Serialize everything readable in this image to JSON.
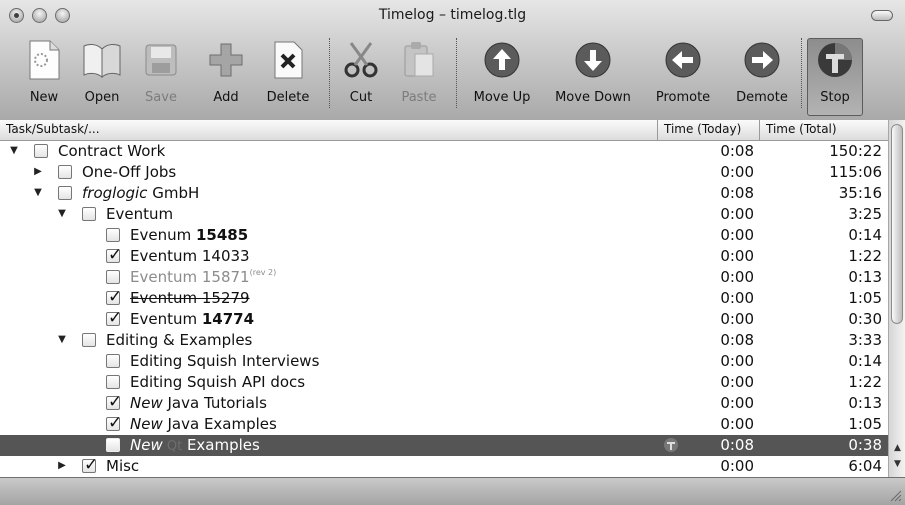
{
  "window": {
    "title": "Timelog – timelog.tlg"
  },
  "toolbar": {
    "items": [
      {
        "key": "new",
        "label": "New",
        "icon": "new-document-icon",
        "enabled": true
      },
      {
        "key": "open",
        "label": "Open",
        "icon": "open-book-icon",
        "enabled": true
      },
      {
        "key": "save",
        "label": "Save",
        "icon": "floppy-disk-icon",
        "enabled": false
      },
      {
        "key": "add",
        "label": "Add",
        "icon": "plus-icon",
        "enabled": true
      },
      {
        "key": "delete",
        "label": "Delete",
        "icon": "delete-document-icon",
        "enabled": true
      },
      {
        "key": "cut",
        "label": "Cut",
        "icon": "scissors-icon",
        "enabled": true
      },
      {
        "key": "paste",
        "label": "Paste",
        "icon": "clipboard-icon",
        "enabled": false
      },
      {
        "key": "moveup",
        "label": "Move Up",
        "icon": "arrow-up-circle-icon",
        "enabled": true
      },
      {
        "key": "movedown",
        "label": "Move Down",
        "icon": "arrow-down-circle-icon",
        "enabled": true
      },
      {
        "key": "promote",
        "label": "Promote",
        "icon": "arrow-left-circle-icon",
        "enabled": true
      },
      {
        "key": "demote",
        "label": "Demote",
        "icon": "arrow-right-circle-icon",
        "enabled": true
      },
      {
        "key": "stop",
        "label": "Stop",
        "icon": "stop-timer-icon",
        "enabled": true,
        "pressed": true
      }
    ]
  },
  "columns": {
    "task": "Task/Subtask/...",
    "today": "Time (Today)",
    "total": "Time (Total)"
  },
  "rows": [
    {
      "level": 0,
      "expander": "open",
      "checked": false,
      "parts": [
        {
          "t": "Contract Work"
        }
      ],
      "today": "0:08",
      "total": "150:22"
    },
    {
      "level": 1,
      "expander": "closed",
      "checked": false,
      "parts": [
        {
          "t": "One-Off Jobs"
        }
      ],
      "today": "0:00",
      "total": "115:06"
    },
    {
      "level": 1,
      "expander": "open",
      "checked": false,
      "parts": [
        {
          "t": "froglogic",
          "s": "i"
        },
        {
          "t": " GmbH"
        }
      ],
      "today": "0:08",
      "total": "35:16"
    },
    {
      "level": 2,
      "expander": "open",
      "checked": false,
      "parts": [
        {
          "t": "Eventum"
        }
      ],
      "today": "0:00",
      "total": "3:25"
    },
    {
      "level": 3,
      "expander": "none",
      "checked": false,
      "parts": [
        {
          "t": "Evenum "
        },
        {
          "t": "15485",
          "s": "b"
        }
      ],
      "today": "0:00",
      "total": "0:14"
    },
    {
      "level": 3,
      "expander": "none",
      "checked": true,
      "parts": [
        {
          "t": "Eventum 14033"
        }
      ],
      "today": "0:00",
      "total": "1:22"
    },
    {
      "level": 3,
      "expander": "none",
      "checked": false,
      "style": "gray",
      "parts": [
        {
          "t": "Eventum 15871"
        },
        {
          "t": "(rev 2)",
          "s": "sup"
        }
      ],
      "today": "0:00",
      "total": "0:13"
    },
    {
      "level": 3,
      "expander": "none",
      "checked": true,
      "style": "strike",
      "parts": [
        {
          "t": "Eventum 15279"
        }
      ],
      "today": "0:00",
      "total": "1:05"
    },
    {
      "level": 3,
      "expander": "none",
      "checked": true,
      "parts": [
        {
          "t": "Eventum "
        },
        {
          "t": "14774",
          "s": "b"
        }
      ],
      "today": "0:00",
      "total": "0:30"
    },
    {
      "level": 2,
      "expander": "open",
      "checked": false,
      "parts": [
        {
          "t": "Editing & Examples"
        }
      ],
      "today": "0:08",
      "total": "3:33"
    },
    {
      "level": 3,
      "expander": "none",
      "checked": false,
      "parts": [
        {
          "t": "Editing Squish Interviews"
        }
      ],
      "today": "0:00",
      "total": "0:14"
    },
    {
      "level": 3,
      "expander": "none",
      "checked": false,
      "parts": [
        {
          "t": "Editing Squish API docs"
        }
      ],
      "today": "0:00",
      "total": "1:22"
    },
    {
      "level": 3,
      "expander": "none",
      "checked": true,
      "parts": [
        {
          "t": "New",
          "s": "i"
        },
        {
          "t": " Java Tutorials"
        }
      ],
      "today": "0:00",
      "total": "0:13"
    },
    {
      "level": 3,
      "expander": "none",
      "checked": true,
      "parts": [
        {
          "t": "New",
          "s": "i"
        },
        {
          "t": " Java Examples"
        }
      ],
      "today": "0:00",
      "total": "1:05"
    },
    {
      "level": 3,
      "expander": "none",
      "checked": false,
      "selected": true,
      "running": true,
      "parts": [
        {
          "t": "New",
          "s": "i"
        },
        {
          "t": " Qt",
          "s": "ghost"
        },
        {
          "t": " Examples"
        }
      ],
      "today": "0:08",
      "total": "0:38"
    },
    {
      "level": 2,
      "expander": "closed",
      "checked": true,
      "parts": [
        {
          "t": "Misc"
        }
      ],
      "today": "0:00",
      "total": "6:04"
    }
  ]
}
